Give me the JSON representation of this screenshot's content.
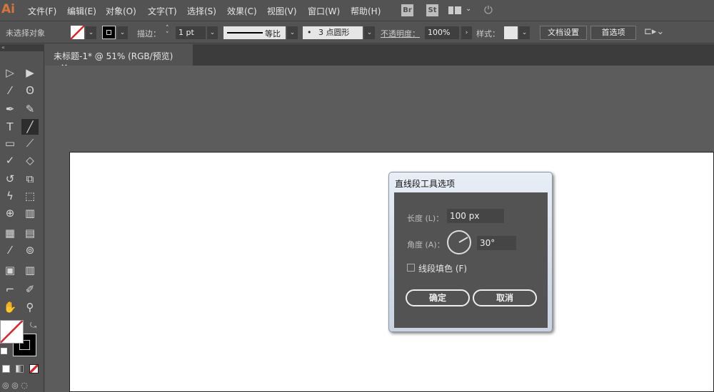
{
  "app": {
    "logo": "Ai"
  },
  "menu": [
    "文件(F)",
    "编辑(E)",
    "对象(O)",
    "文字(T)",
    "选择(S)",
    "效果(C)",
    "视图(V)",
    "窗口(W)",
    "帮助(H)"
  ],
  "menubar_icons": {
    "bridge": "Br",
    "stock": "St",
    "layout": "layout-icon",
    "sync": "sync-icon"
  },
  "control": {
    "selection": "未选择对象",
    "stroke_label": "描边：",
    "stroke_value": "1 pt",
    "profile": "等比",
    "brush": "3 点圆形",
    "brush_dot": "•",
    "opacity_label": "不透明度：",
    "opacity": "100%",
    "style_label": "样式：",
    "doc_setup": "文档设置",
    "prefs": "首选项"
  },
  "tab": {
    "title": "未标题-1* @ 51% (RGB/预览)",
    "close": "×"
  },
  "tools": [
    "selection",
    "direct-selection",
    "magic-wand",
    "lasso",
    "pen",
    "curvature",
    "type",
    "line-segment",
    "rectangle",
    "paintbrush",
    "shaper",
    "eraser",
    "rotate",
    "scale",
    "warp",
    "free-transform",
    "shape-builder",
    "perspective-grid",
    "mesh",
    "gradient",
    "eyedropper",
    "blend",
    "symbol-sprayer",
    "column-graph",
    "artboard",
    "slice",
    "hand",
    "zoom"
  ],
  "active_tool": "line-segment",
  "dialog": {
    "title": "直线段工具选项",
    "length_label": "长度 (L)：",
    "length": "100 px",
    "angle_label": "角度 (A)：",
    "angle": "30°",
    "angle_value": 30,
    "fill_label": "线段填色 (F)",
    "fill_checked": false,
    "ok": "确定",
    "cancel": "取消"
  },
  "colors": {
    "accent": "#d9743a",
    "none_slash": "#e0242a"
  }
}
